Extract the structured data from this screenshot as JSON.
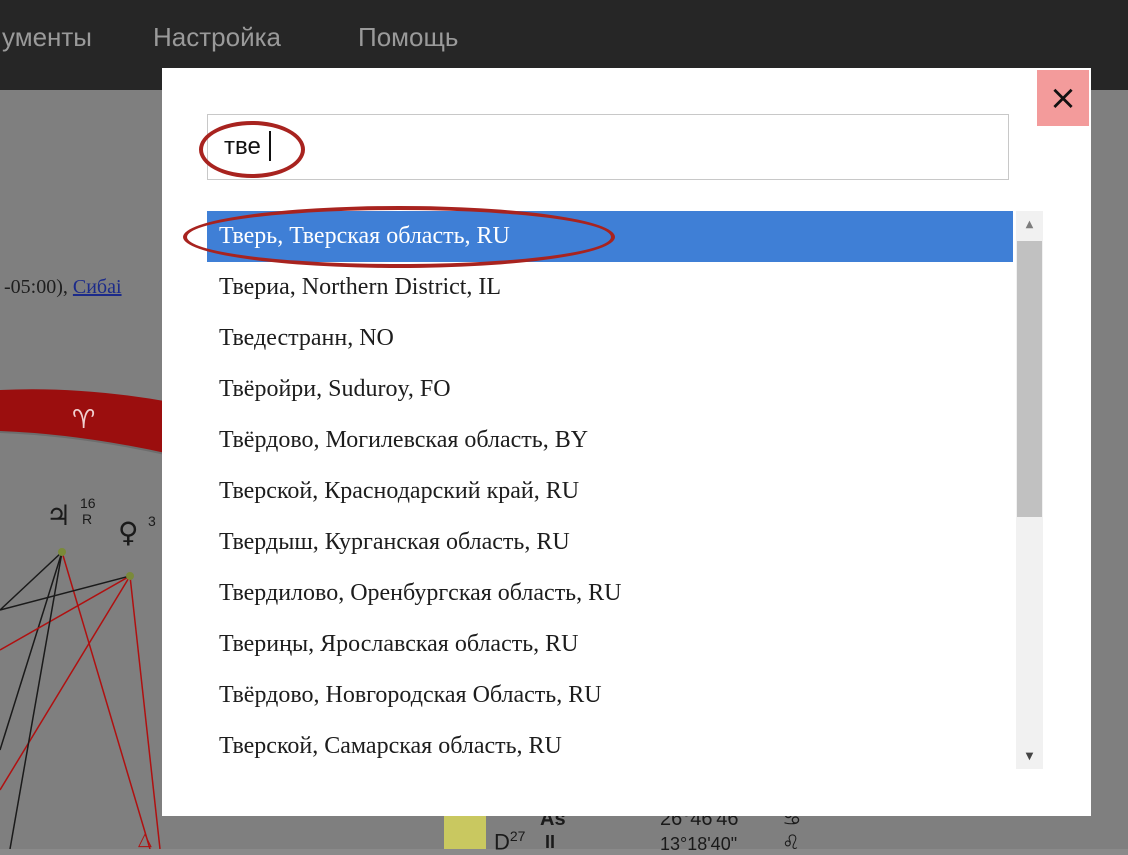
{
  "menu": {
    "tools_label": "ументы",
    "settings_label": "Настройка",
    "help_label": "Помощь"
  },
  "background": {
    "timezone_text": "-05:00),",
    "timezone_link": "Сибаі",
    "aries_glyph": "♈",
    "jupiter_glyph": "♃",
    "jupiter_degree": "16",
    "jupiter_retro": "R",
    "venus_glyph": "♀",
    "venus_degree": "3",
    "as_label": "As",
    "as_value": "26°46'46\"",
    "as_sign": "♋",
    "ii_label": "II",
    "ii_value": "13°18'40\"",
    "ii_sign": "♌",
    "d_label": "D",
    "d_degree": "27"
  },
  "modal": {
    "close_icon": "×",
    "search": {
      "value": "тве"
    },
    "results": [
      {
        "label": "Тверь, Тверская область, RU",
        "selected": true
      },
      {
        "label": "Твериа, Northern District, IL"
      },
      {
        "label": "Тведестранн, NO"
      },
      {
        "label": "Твёройри, Suduroy, FO"
      },
      {
        "label": "Твёрдово, Могилевская область, BY"
      },
      {
        "label": "Тверской, Краснодарский край, RU"
      },
      {
        "label": "Твердыш, Курганская область, RU"
      },
      {
        "label": "Твердилово, Оренбургская область, RU"
      },
      {
        "label": "Твериңы, Ярославская область, RU"
      },
      {
        "label": "Твёрдово, Новгородская Область, RU"
      },
      {
        "label": "Тверской, Самарская область, RU"
      }
    ],
    "scroll_up_icon": "▲",
    "scroll_down_icon": "▼"
  },
  "colors": {
    "selected_bg": "#3f7fd6",
    "close_bg": "#f39b9b",
    "annotation_ring": "#a8231f",
    "chart_red": "#b01010"
  }
}
